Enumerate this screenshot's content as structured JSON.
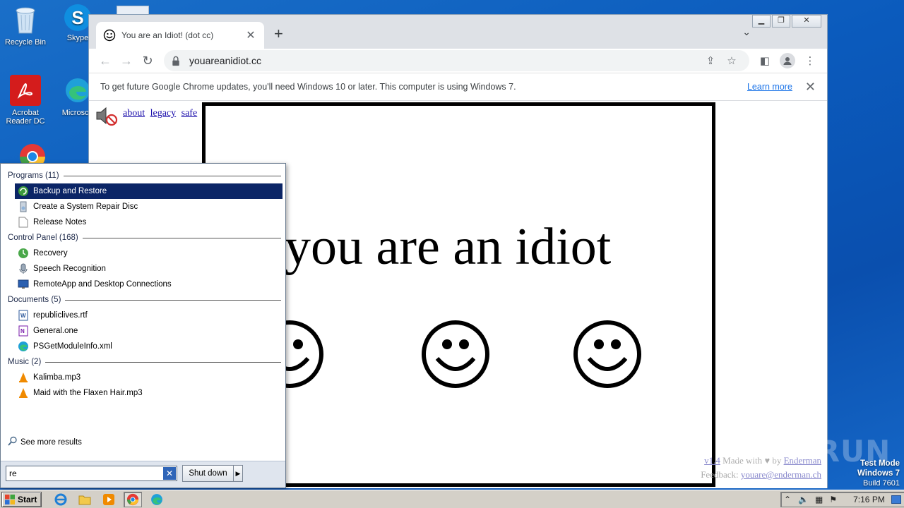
{
  "desktop": {
    "icons": [
      {
        "label": "Recycle Bin"
      },
      {
        "label": "Skype"
      },
      {
        "label": "Acrobat Reader DC"
      },
      {
        "label": "Microsoft"
      }
    ]
  },
  "browser": {
    "tab_title": "You are an Idiot! (dot cc)",
    "url": "youareanidiot.cc",
    "infobar": {
      "message": "To get future Google Chrome updates, you'll need Windows 10 or later. This computer is using Windows 7.",
      "link": "Learn more"
    }
  },
  "page": {
    "links": [
      "about",
      "legacy",
      "safe"
    ],
    "headline": "you are an idiot",
    "credits": {
      "version": "v1.4",
      "made_with": "Made with",
      "by": "by",
      "author": "Enderman",
      "feedback_label": "Feedback:",
      "email": "youare@enderman.ch"
    }
  },
  "start_menu": {
    "groups": [
      {
        "header": "Programs (11)",
        "items": [
          "Backup and Restore",
          "Create a System Repair Disc",
          "Release Notes"
        ]
      },
      {
        "header": "Control Panel (168)",
        "items": [
          "Recovery",
          "Speech Recognition",
          "RemoteApp and Desktop Connections"
        ]
      },
      {
        "header": "Documents (5)",
        "items": [
          "republiclives.rtf",
          "General.one",
          "PSGetModuleInfo.xml"
        ]
      },
      {
        "header": "Music (2)",
        "items": [
          "Kalimba.mp3",
          "Maid with the Flaxen Hair.mp3"
        ]
      }
    ],
    "see_more": "See more results",
    "search_value": "re",
    "shutdown_label": "Shut down"
  },
  "taskbar": {
    "start_label": "Start",
    "clock": "7:16 PM"
  },
  "watermark": {
    "line1": "Test Mode",
    "line2": "Windows 7",
    "line3": "Build 7601",
    "anyrun": "ANY RUN"
  }
}
